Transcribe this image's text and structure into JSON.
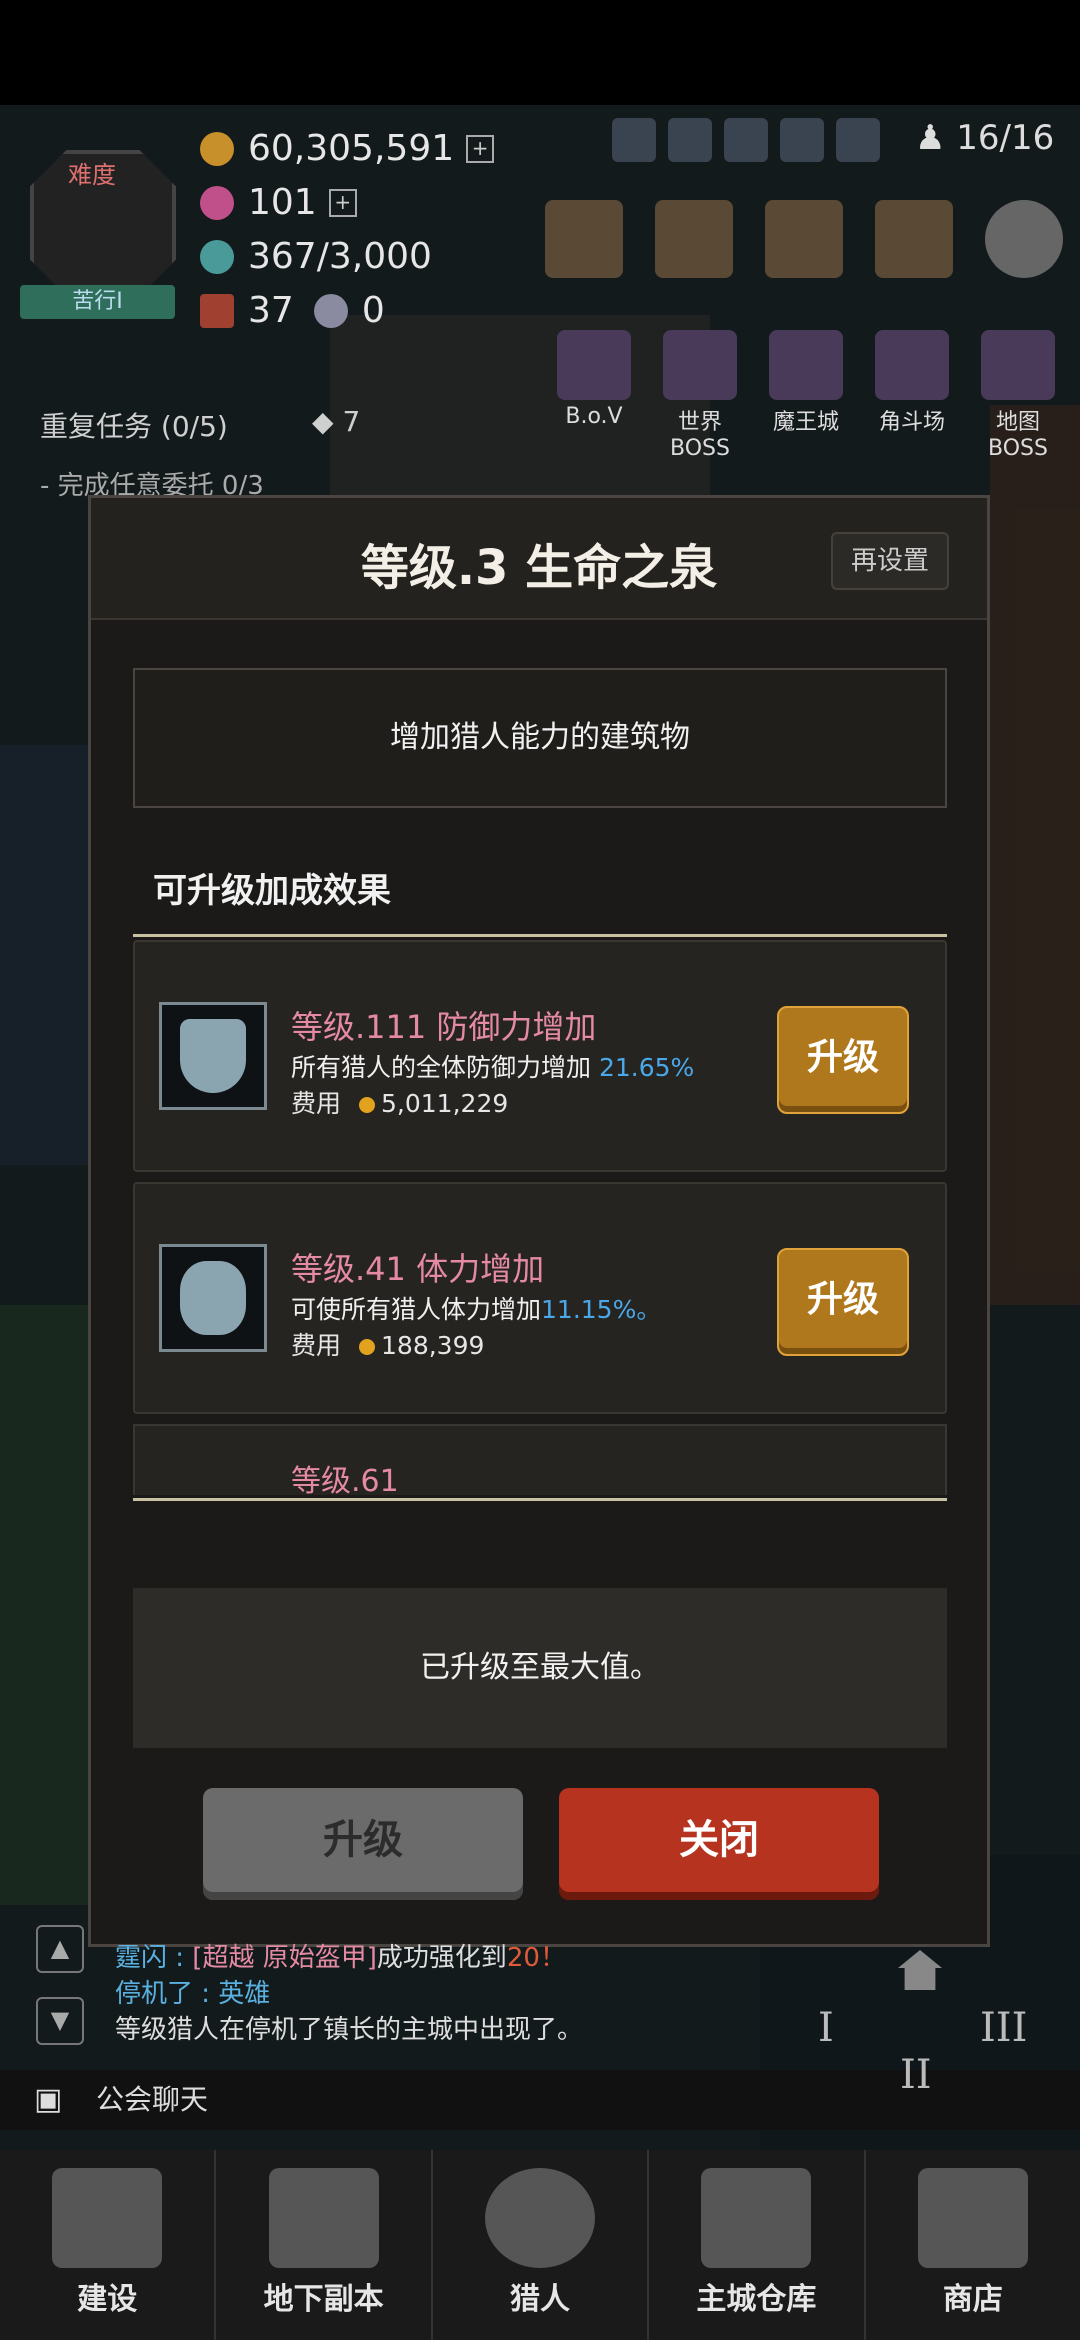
{
  "hud": {
    "difficulty_label": "难度",
    "difficulty_mode": "苦行I",
    "gold": "60,305,591",
    "gems": "101",
    "stamina": "367/3,000",
    "chest": "37",
    "crystal": "0",
    "hunters": "16/16"
  },
  "bosses": [
    {
      "label": "B.o.V"
    },
    {
      "label": "世界BOSS"
    },
    {
      "label": "魔王城"
    },
    {
      "label": "角斗场"
    },
    {
      "label": "地图BOSS"
    }
  ],
  "quest": {
    "repeat_label": "重复任务 (0/5)",
    "gem_reward": "7",
    "sub": "- 完成任意委托 0/3"
  },
  "modal": {
    "title": "等级.3 生命之泉",
    "reset_label": "再设置",
    "description": "增加猎人能力的建筑物",
    "section_title": "可升级加成效果",
    "items": [
      {
        "name": "等级.111 防御力增加",
        "desc": "所有猎人的全体防御力增加 ",
        "pct": "21.65%",
        "cost_label": "费用",
        "cost": "5,011,229",
        "button": "升级"
      },
      {
        "name": "等级.41 体力增加",
        "desc": "可使所有猎人体力增加",
        "pct": "11.15%。",
        "cost_label": "费用",
        "cost": "188,399",
        "button": "升级"
      },
      {
        "name": "等级.61"
      }
    ],
    "max_message": "已升级至最大值。",
    "upgrade_label": "升级",
    "close_label": "关闭"
  },
  "chat": {
    "line1_prefix": "霆闪 : ",
    "line1_item": "[超越 原始盔甲]",
    "line1_mid": "成功强化到",
    "line1_level": "20！",
    "line2_prefix": "停机了 : ",
    "line2_name": "英雄",
    "line3": "等级猎人在停机了镇长的主城中出现了。",
    "guild_chat": "公会聊天"
  },
  "nav": [
    {
      "label": "建设"
    },
    {
      "label": "地下副本"
    },
    {
      "label": "猎人"
    },
    {
      "label": "主城仓库"
    },
    {
      "label": "商店"
    }
  ],
  "roman": {
    "r1": "I",
    "r2": "II",
    "r3": "III"
  }
}
